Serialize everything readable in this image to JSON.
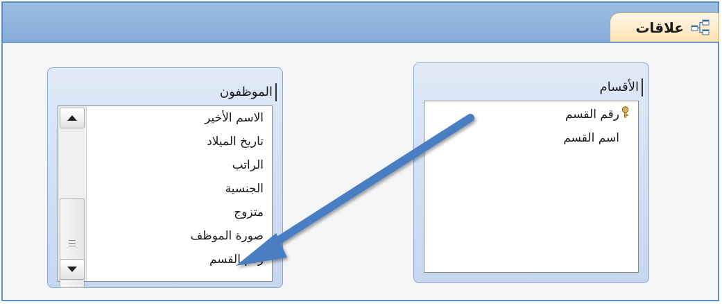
{
  "tab": {
    "label": "علاقات",
    "icon": "relationships-icon"
  },
  "tables": {
    "departments": {
      "title": "الأقسام",
      "fields": [
        {
          "label": "رقم القسم",
          "primary_key": true
        },
        {
          "label": "اسم القسم",
          "primary_key": false
        }
      ]
    },
    "employees": {
      "title": "الموظفون",
      "fields": [
        {
          "label": "الاسم الأخير"
        },
        {
          "label": "تاريخ الميلاد"
        },
        {
          "label": "الراتب"
        },
        {
          "label": "الجنسية"
        },
        {
          "label": "متزوج"
        },
        {
          "label": "صورة الموظف"
        },
        {
          "label": "رقم القسم"
        }
      ]
    }
  },
  "colors": {
    "tabbar": "#86acd9",
    "active_tab": "#ffe2b0",
    "arrow": "#4a7ec2"
  }
}
